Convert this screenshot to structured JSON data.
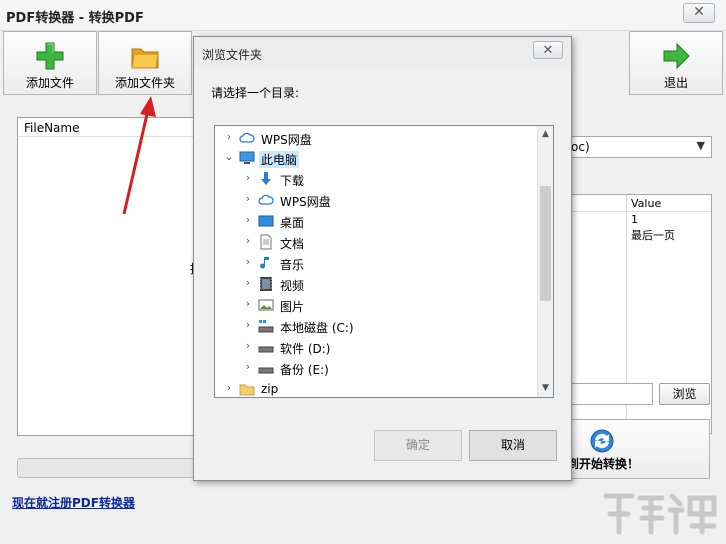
{
  "window": {
    "title": "PDF转换器 - 转换PDF",
    "close_glyph": "✕"
  },
  "toolbar": {
    "add_file": "添加文件",
    "add_folder": "添加文件夹",
    "exit": "退出"
  },
  "file_list": {
    "column": "FileName",
    "partial_hint": "拖"
  },
  "format_select": {
    "value": "oc)"
  },
  "props_table": {
    "column": "Value",
    "values": [
      "1",
      "最后一页"
    ]
  },
  "browse_button": "浏览",
  "start_button": "到开始转换！",
  "register_link": "现在就注册PDF转换器",
  "dialog": {
    "title": "浏览文件夹",
    "close_glyph": "✕",
    "prompt": "请选择一个目录:",
    "tree": [
      {
        "label": "WPS网盘",
        "icon": "cloud-icon",
        "expanded": false,
        "level": 0
      },
      {
        "label": "此电脑",
        "icon": "computer-icon",
        "expanded": true,
        "level": 0
      },
      {
        "label": "下载",
        "icon": "download-icon",
        "expanded": false,
        "level": 1
      },
      {
        "label": "WPS网盘",
        "icon": "cloud-icon",
        "expanded": false,
        "level": 1
      },
      {
        "label": "桌面",
        "icon": "desktop-icon",
        "expanded": false,
        "level": 1
      },
      {
        "label": "文档",
        "icon": "document-icon",
        "expanded": false,
        "level": 1
      },
      {
        "label": "音乐",
        "icon": "music-icon",
        "expanded": false,
        "level": 1
      },
      {
        "label": "视频",
        "icon": "video-icon",
        "expanded": false,
        "level": 1
      },
      {
        "label": "图片",
        "icon": "picture-icon",
        "expanded": false,
        "level": 1
      },
      {
        "label": "本地磁盘 (C:)",
        "icon": "system-drive-icon",
        "expanded": false,
        "level": 1
      },
      {
        "label": "软件 (D:)",
        "icon": "drive-icon",
        "expanded": false,
        "level": 1
      },
      {
        "label": "备份 (E:)",
        "icon": "drive-icon",
        "expanded": false,
        "level": 1
      },
      {
        "label": "zip",
        "icon": "folder-icon",
        "expanded": false,
        "level": 0
      }
    ],
    "ok": "确定",
    "cancel": "取消"
  },
  "colors": {
    "accent_red_arrow": "#d42020",
    "selection": "#cce8ff",
    "link": "#0a2a9a"
  }
}
